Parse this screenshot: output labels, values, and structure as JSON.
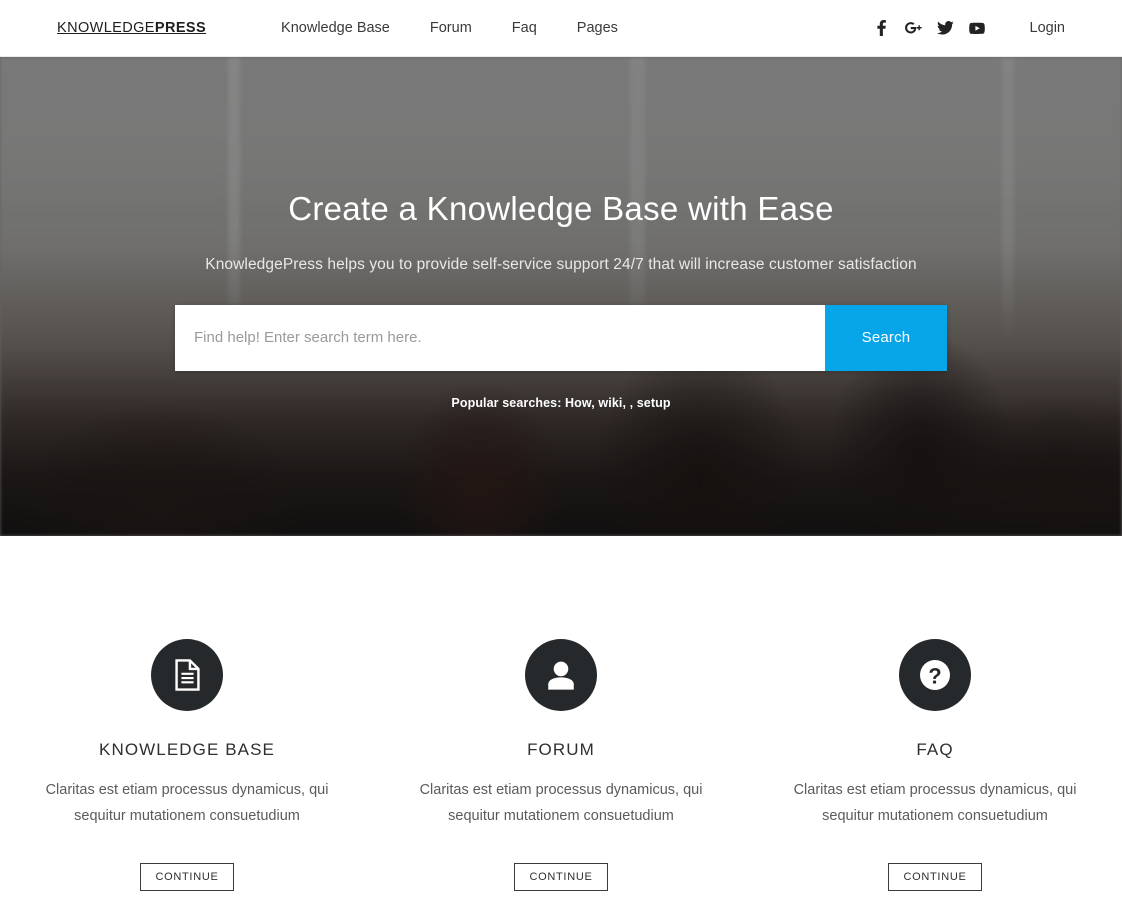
{
  "header": {
    "logo_light": "KNOWLEDGE",
    "logo_bold": "PRESS",
    "nav": [
      {
        "label": "Knowledge Base"
      },
      {
        "label": "Forum"
      },
      {
        "label": "Faq"
      },
      {
        "label": "Pages"
      }
    ],
    "socials": [
      {
        "name": "facebook-icon",
        "title": "Facebook"
      },
      {
        "name": "google-plus-icon",
        "title": "Google Plus"
      },
      {
        "name": "twitter-icon",
        "title": "Twitter"
      },
      {
        "name": "youtube-icon",
        "title": "YouTube"
      }
    ],
    "login_label": "Login"
  },
  "hero": {
    "title": "Create a Knowledge Base with Ease",
    "subtitle": "KnowledgePress helps you to provide self-service support 24/7 that will increase customer satisfaction",
    "search_placeholder": "Find help! Enter search term here.",
    "search_value": "",
    "search_button": "Search",
    "popular_searches": "Popular searches: How, wiki, , setup",
    "accent_color": "#06a5e8"
  },
  "features": [
    {
      "icon": "document-icon",
      "title": "KNOWLEDGE BASE",
      "description": "Claritas est etiam processus dynamicus, qui sequitur mutationem consuetudium",
      "button": "CONTINUE"
    },
    {
      "icon": "user-icon",
      "title": "FORUM",
      "description": "Claritas est etiam processus dynamicus, qui sequitur mutationem consuetudium",
      "button": "CONTINUE"
    },
    {
      "icon": "question-mark-icon",
      "title": "FAQ",
      "description": "Claritas est etiam processus dynamicus, qui sequitur mutationem consuetudium",
      "button": "CONTINUE"
    }
  ]
}
